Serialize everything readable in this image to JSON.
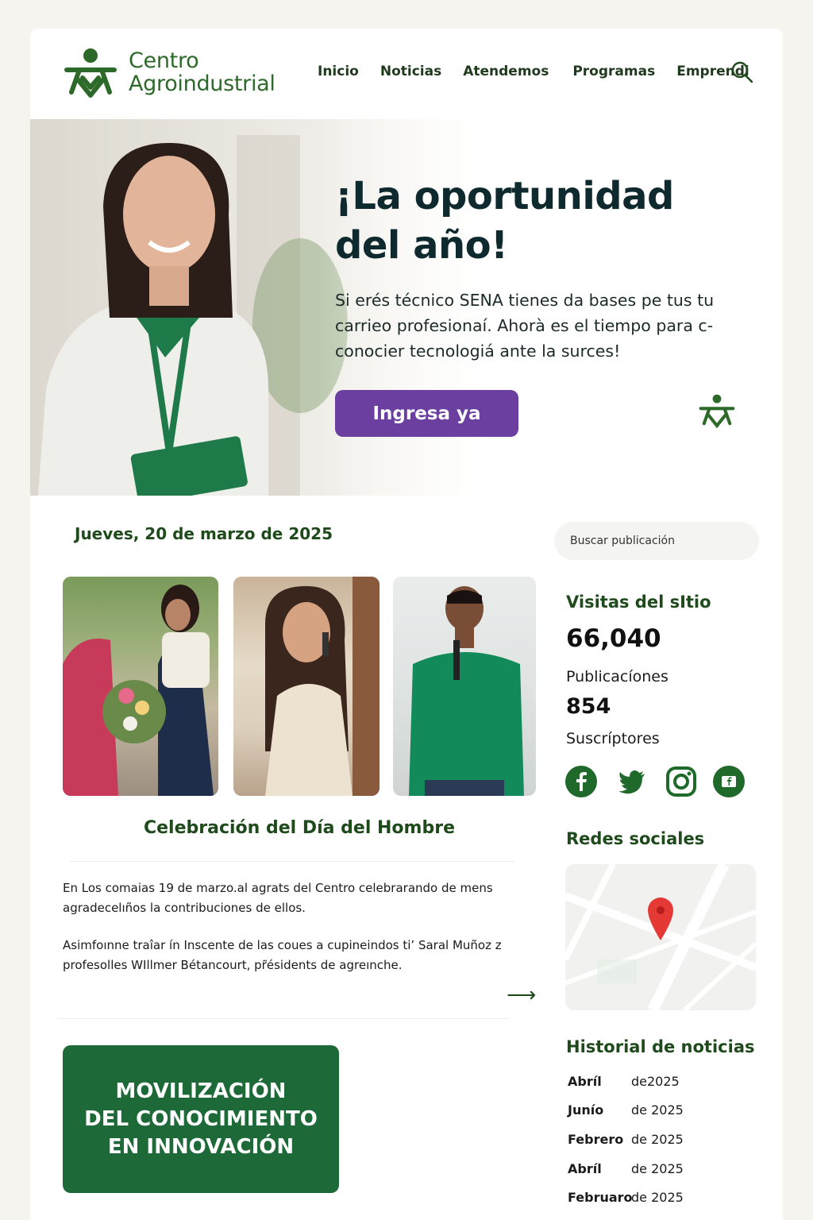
{
  "brand": {
    "line1": "Centro",
    "line2": "Agroindustrial",
    "color": "#2d6a2a"
  },
  "nav": [
    "Inicio",
    "Noticias",
    "Atendemos",
    "Programas",
    "Emprendi"
  ],
  "hero": {
    "title_line1": "¡La oportunidad",
    "title_line2": "del año!",
    "text_line1": "Si  erés técnico SENA tienes da bases pe tus tu",
    "text_line2": "carrieo profesionaí. Ahorà es el tiempo para c-",
    "text_line3": "conocier tecnologiá ante la surces!",
    "cta": "Ingresa ya",
    "cta_color": "#6a3fa0"
  },
  "date": "Jueves, 20 de marzo de 2025",
  "search": {
    "placeholder": "Buscar publicación"
  },
  "event": {
    "title": "Celebración del Día del Hombre",
    "para1_line1": "En  Los comaias   19  de  marzo.al agrats del Centro celebrarando de mens",
    "para1_line2": "agradecelıños la contribuciones de ellos.",
    "para2_line1": "Asimfoınne traîar ín Inscente de las coues a cupineindos ti’ Saral Muñoz z",
    "para2_line2": "profesolles WIllmer  Bétancourt, pr̃ésidents de agreınche."
  },
  "banner": {
    "line1": "MOVILIZACIÓN",
    "line2": "DEL CONOCIMIENTO",
    "line3": "EN INNOVACIÓN",
    "color": "#1d6a38"
  },
  "stats": {
    "visits_label": "Visitas del sItio",
    "visits_value": "66,040",
    "posts_label": "Publicacíones",
    "posts_value": "854",
    "subs_label": "Suscríptores"
  },
  "social": {
    "heading": "Redes sociales",
    "icons": [
      "facebook-icon",
      "twitter-icon",
      "instagram-icon",
      "facebook-square-icon"
    ]
  },
  "history": {
    "heading": "Historial de noticias",
    "items": [
      {
        "month": "Abríl",
        "year": "de2025"
      },
      {
        "month": "Junío",
        "year": "de 2025"
      },
      {
        "month": "Febrero",
        "year": "de 2025"
      },
      {
        "month": "Abríl",
        "year": "de 2025"
      },
      {
        "month": "Februaro",
        "year": "de 2025"
      }
    ]
  },
  "accent_green": "#1f4a1c"
}
